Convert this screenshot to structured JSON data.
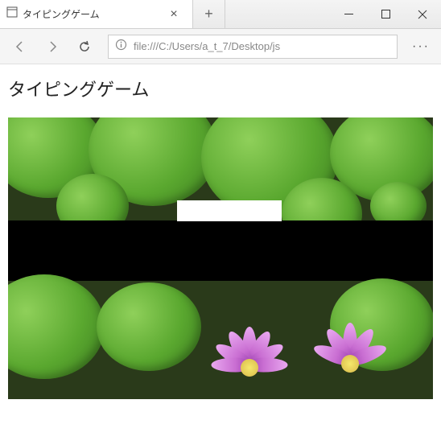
{
  "titlebar": {
    "tab_title": "タイピングゲーム",
    "tab_icon": "page-icon",
    "close_label": "×",
    "newtab_label": "+"
  },
  "toolbar": {
    "url": "file:///C:/Users/a_t_7/Desktop/js",
    "info_icon": "info-icon",
    "more_label": "···"
  },
  "page": {
    "heading": "タイピングゲーム"
  }
}
